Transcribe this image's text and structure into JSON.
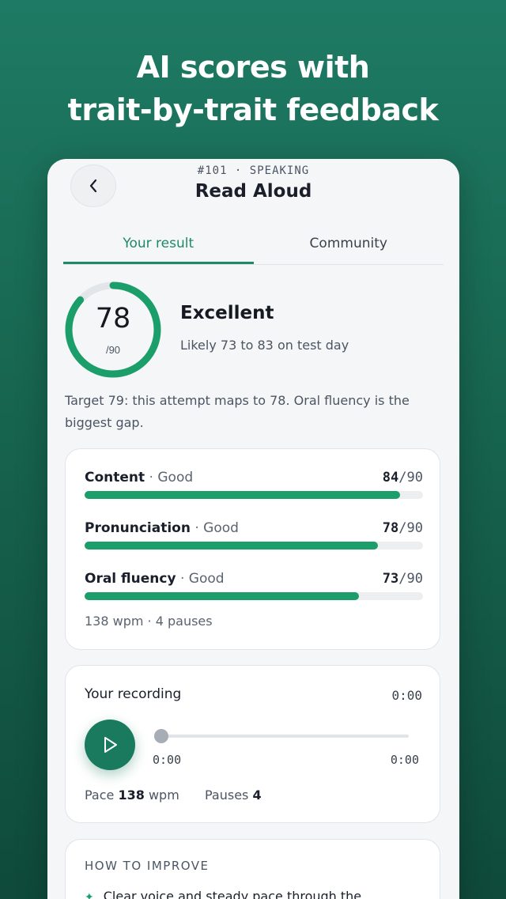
{
  "headline": {
    "line1": "AI scores with",
    "line2": "trait-by-trait feedback"
  },
  "header": {
    "eyebrow": "#101 · SPEAKING",
    "title": "Read Aloud"
  },
  "tabs": [
    {
      "label": "Your result",
      "active": true
    },
    {
      "label": "Community",
      "active": false
    }
  ],
  "score": {
    "value": "78",
    "max": "/90",
    "fraction": 0.8667,
    "verdict": "Excellent",
    "range": "Likely 73 to 83 on test day"
  },
  "summary": "Target 79: this attempt maps to 78. Oral fluency is the biggest gap.",
  "traits": [
    {
      "name": "Content",
      "level": "Good",
      "score": "84",
      "max": "/90",
      "fraction": 0.9333
    },
    {
      "name": "Pronunciation",
      "level": "Good",
      "score": "78",
      "max": "/90",
      "fraction": 0.8667
    },
    {
      "name": "Oral fluency",
      "level": "Good",
      "score": "73",
      "max": "/90",
      "fraction": 0.8111
    }
  ],
  "fluency_note": "138 wpm · 4 pauses",
  "recording": {
    "title": "Your recording",
    "duration": "0:00",
    "current": "0:00",
    "end": "0:00",
    "pace_label": "Pace",
    "pace_value": "138",
    "pace_unit": "wpm",
    "pauses_label": "Pauses",
    "pauses_value": "4"
  },
  "improve": {
    "title": "HOW TO IMPROVE",
    "tip1": "Clear voice and steady pace through the"
  },
  "colors": {
    "accent": "#1b9e6a",
    "play": "#1a7a5e",
    "background": "#17654f"
  },
  "icons": {
    "back": "chevron-left-icon",
    "play": "play-icon",
    "tip": "sparkle-icon"
  }
}
